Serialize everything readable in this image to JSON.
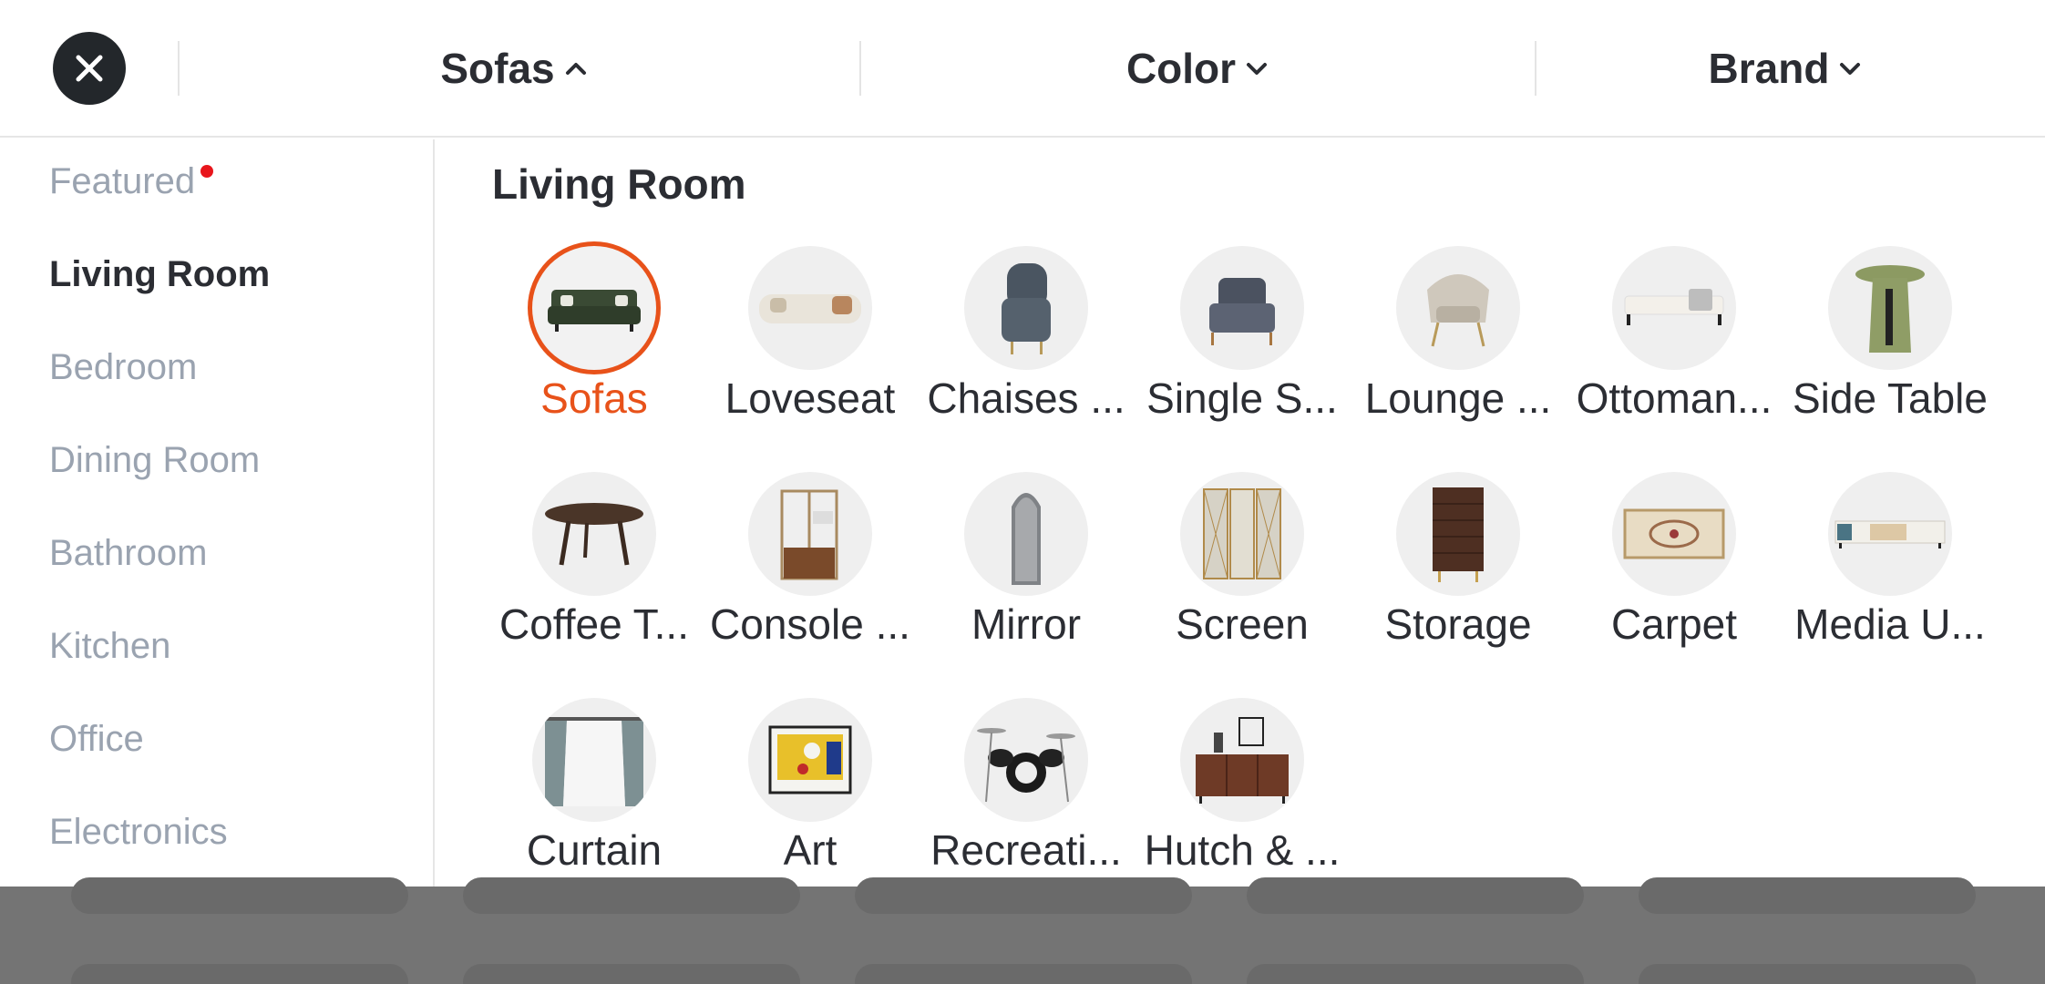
{
  "topbar": {
    "filters": [
      {
        "label": "Sofas",
        "icon": "chevron-up-icon"
      },
      {
        "label": "Color",
        "icon": "chevron-down-icon"
      },
      {
        "label": "Brand",
        "icon": "chevron-down-icon"
      }
    ]
  },
  "sidebar": {
    "items": [
      {
        "label": "Featured",
        "badge": "red-dot"
      },
      {
        "label": "Living Room",
        "active": true
      },
      {
        "label": "Bedroom"
      },
      {
        "label": "Dining Room"
      },
      {
        "label": "Bathroom"
      },
      {
        "label": "Kitchen"
      },
      {
        "label": "Office"
      },
      {
        "label": "Electronics"
      }
    ]
  },
  "main": {
    "section_title": "Living Room",
    "items": [
      {
        "label": "Sofas",
        "icon": "sofa-icon",
        "selected": true
      },
      {
        "label": "Loveseat",
        "icon": "loveseat-icon"
      },
      {
        "label": "Chaises ...",
        "icon": "chaise-icon"
      },
      {
        "label": "Single S...",
        "icon": "armchair-icon"
      },
      {
        "label": "Lounge ...",
        "icon": "lounge-chair-icon"
      },
      {
        "label": "Ottoman...",
        "icon": "ottoman-icon"
      },
      {
        "label": "Side Table",
        "icon": "side-table-icon"
      },
      {
        "label": "Coffee T...",
        "icon": "coffee-table-icon"
      },
      {
        "label": "Console ...",
        "icon": "console-icon"
      },
      {
        "label": "Mirror",
        "icon": "mirror-icon"
      },
      {
        "label": "Screen",
        "icon": "screen-icon"
      },
      {
        "label": "Storage",
        "icon": "storage-icon"
      },
      {
        "label": "Carpet",
        "icon": "carpet-icon"
      },
      {
        "label": "Media U...",
        "icon": "media-unit-icon"
      },
      {
        "label": "Curtain",
        "icon": "curtain-icon"
      },
      {
        "label": "Art",
        "icon": "art-icon"
      },
      {
        "label": "Recreati...",
        "icon": "drums-icon"
      },
      {
        "label": "Hutch & ...",
        "icon": "hutch-icon"
      }
    ]
  },
  "colors": {
    "accent": "#e8521a",
    "text_primary": "#2b2d33",
    "text_muted": "#9aa3b0",
    "badge": "#e8161c",
    "close_bg": "#23272b"
  }
}
